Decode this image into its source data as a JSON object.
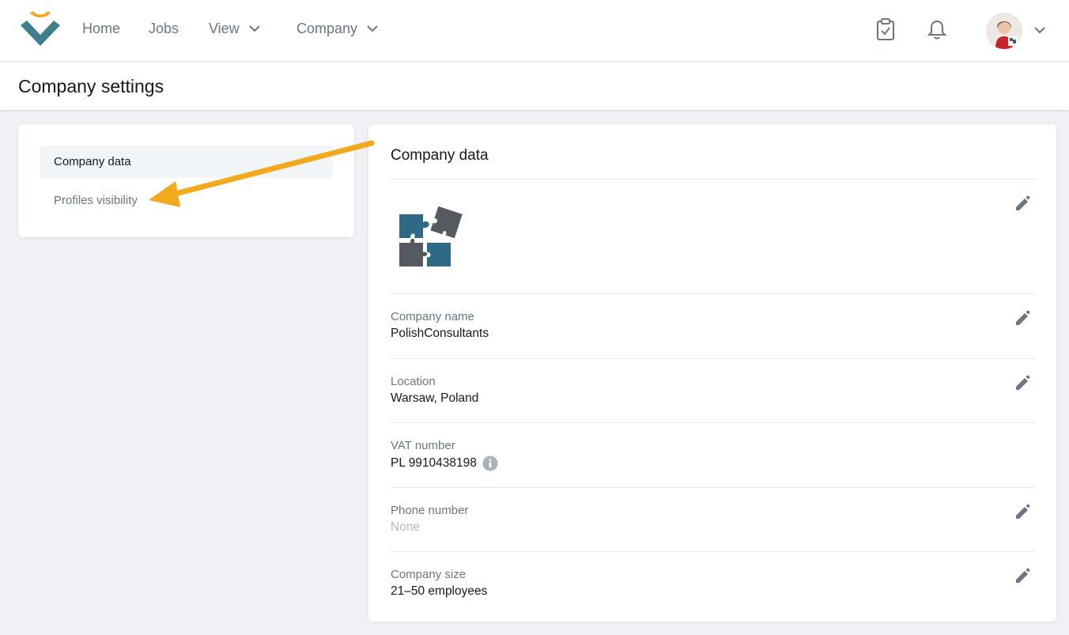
{
  "nav": {
    "home": "Home",
    "jobs": "Jobs",
    "view": "View",
    "company": "Company",
    "icons": [
      "clipboard-check-icon",
      "bell-icon",
      "chevron-down-icon"
    ]
  },
  "header": {
    "title": "Company settings"
  },
  "sidebar": {
    "items": [
      {
        "label": "Company data",
        "active": true
      },
      {
        "label": "Profiles visibility",
        "active": false
      }
    ]
  },
  "main": {
    "title": "Company data",
    "fields": [
      {
        "label": "Company name",
        "value": "PolishConsultants",
        "editable": true
      },
      {
        "label": "Location",
        "value": "Warsaw, Poland",
        "editable": true
      },
      {
        "label": "VAT number",
        "value": "PL 9910438198",
        "editable": false
      },
      {
        "label": "Phone number",
        "value": "None",
        "editable": true
      },
      {
        "label": "Company size",
        "value": "21–50 employees",
        "editable": true
      }
    ]
  },
  "colors": {
    "brand_orange": "#f5a623",
    "brand_teal": "#3f7e8c",
    "puzzle_blue": "#2e6a86",
    "puzzle_gray": "#555a60",
    "annotation_arrow": "#f2a91e"
  }
}
